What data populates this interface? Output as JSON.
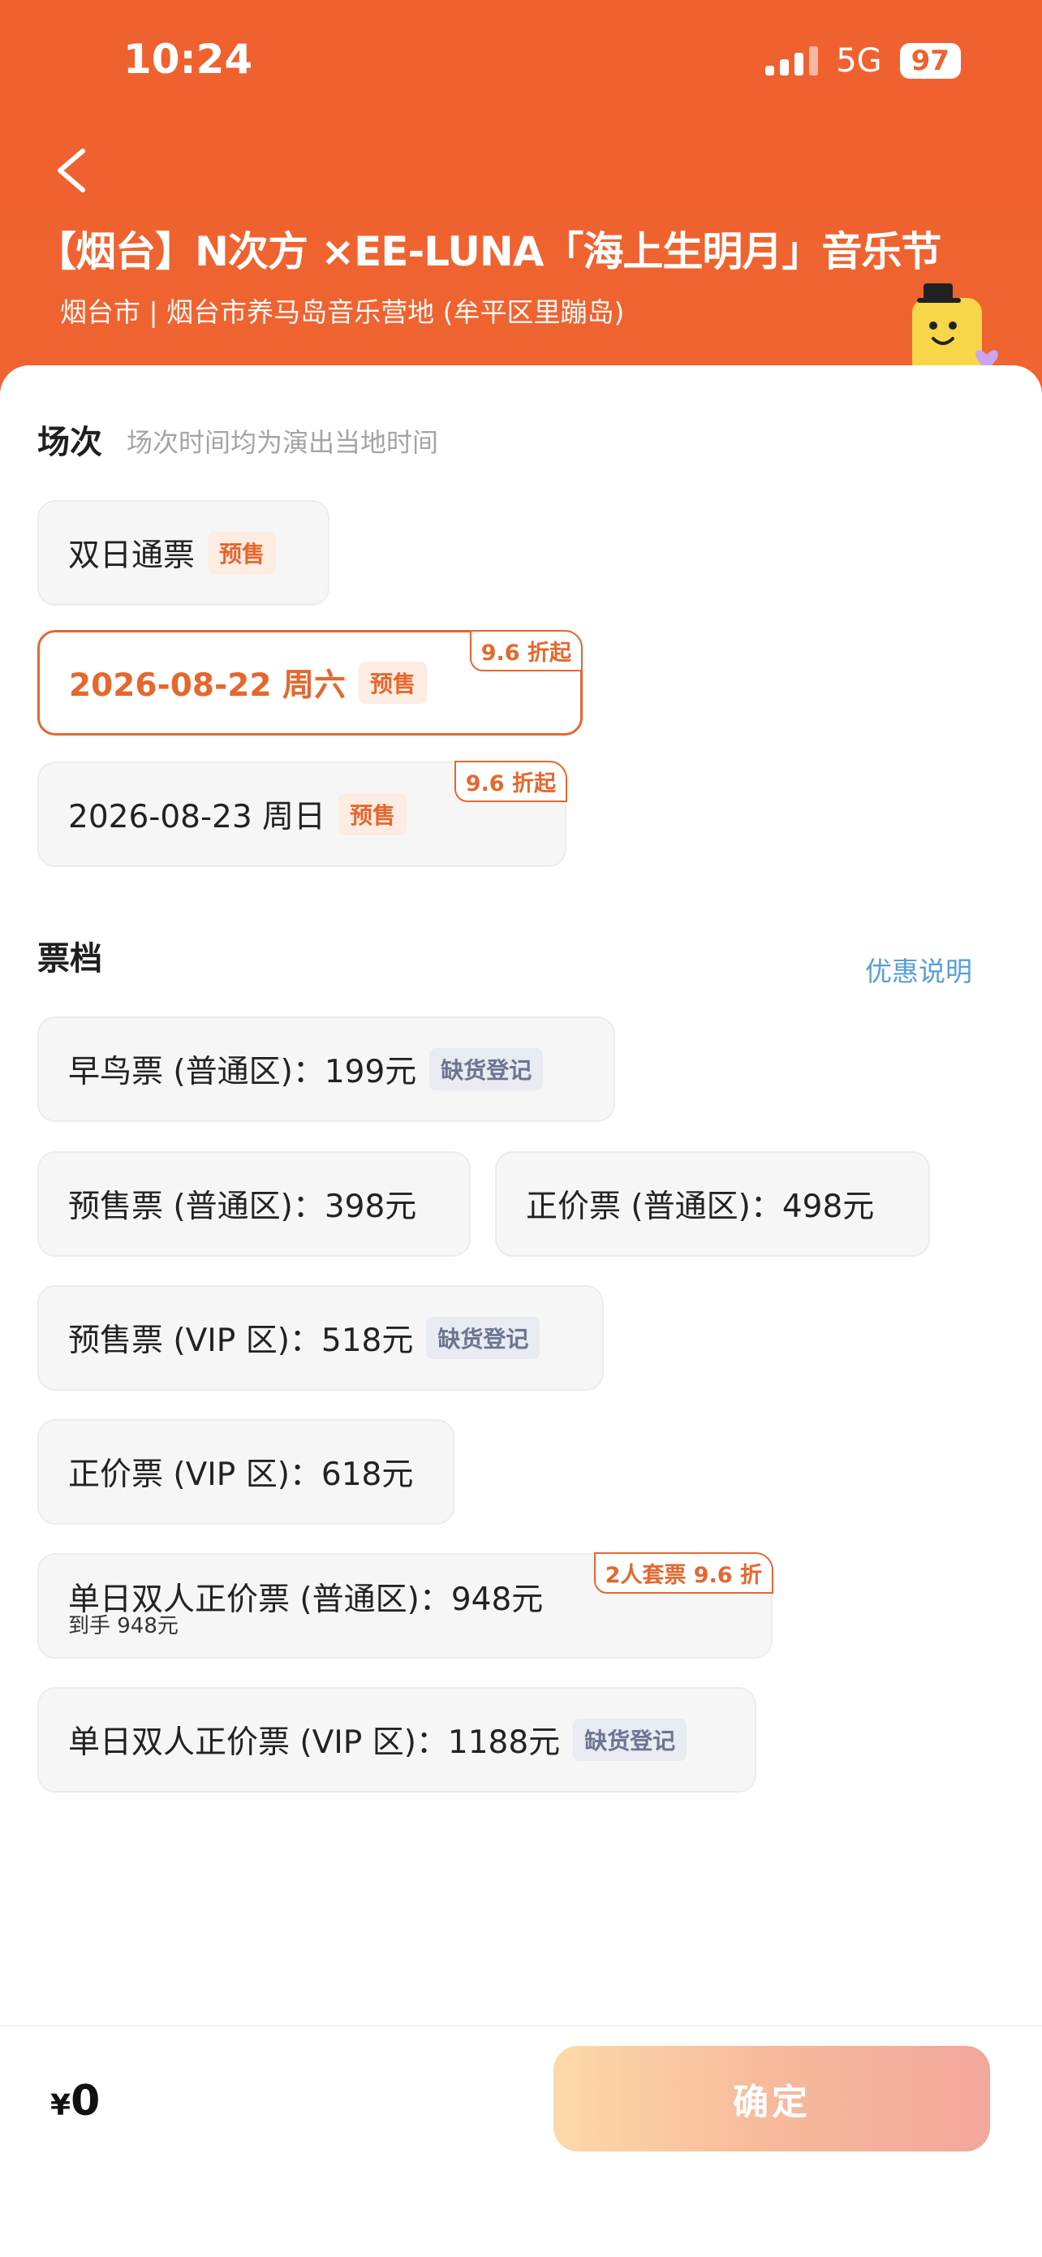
{
  "status_bar": {
    "time": "10:24",
    "network": "5G",
    "battery": "97"
  },
  "header": {
    "title": "【烟台】N次方 ×EE-LUNA「海上生明月」音乐节",
    "subtitle": "烟台市 | 烟台市养马岛音乐营地 (牟平区里蹦岛)"
  },
  "session": {
    "title": "场次",
    "hint": "场次时间均为演出当地时间",
    "options": [
      {
        "label": "双日通票",
        "tag": "预售",
        "corner": ""
      },
      {
        "label": "2026-08-22 周六",
        "tag": "预售",
        "corner": "9.6 折起",
        "selected": true
      },
      {
        "label": "2026-08-23 周日",
        "tag": "预售",
        "corner": "9.6 折起"
      }
    ]
  },
  "tickets": {
    "title": "票档",
    "discount_link": "优惠说明",
    "options": [
      {
        "label": "早鸟票 (普通区)：199元",
        "tag": "缺货登记"
      },
      {
        "label": "预售票 (普通区)：398元"
      },
      {
        "label": "正价票 (普通区)：498元"
      },
      {
        "label": "预售票 (VIP 区)：518元",
        "tag": "缺货登记"
      },
      {
        "label": "正价票 (VIP 区)：618元"
      },
      {
        "label": "单日双人正价票 (普通区)：948元",
        "sub": "到手 948元",
        "corner": "2人套票 9.6 折"
      },
      {
        "label": "单日双人正价票 (VIP 区)：1188元",
        "tag": "缺货登记"
      }
    ]
  },
  "footer": {
    "currency": "¥",
    "amount": "0",
    "confirm_label": "确定"
  },
  "colors": {
    "brand": "#ef612f",
    "accent": "#e5672e",
    "link": "#5a9fd6"
  }
}
